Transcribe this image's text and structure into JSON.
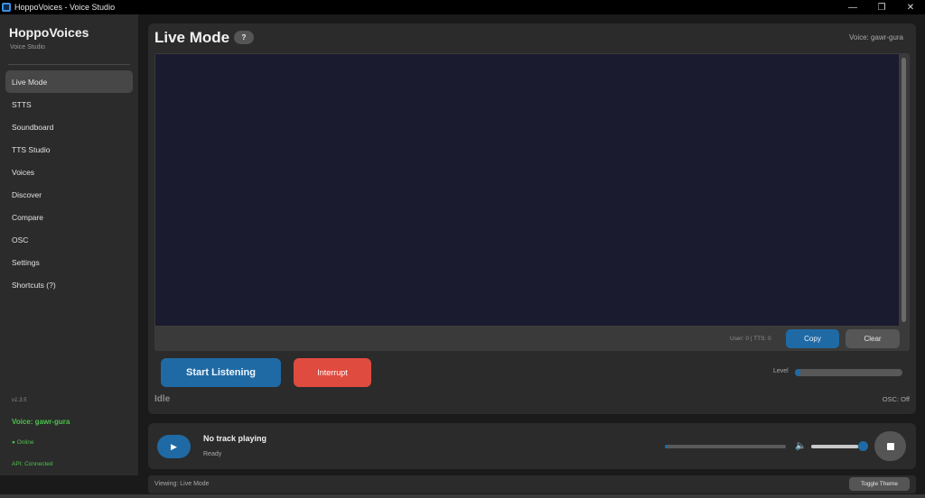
{
  "window": {
    "title": "HoppoVoices - Voice Studio",
    "controls": {
      "minimize": "—",
      "maximize": "❐",
      "close": "✕"
    }
  },
  "sidebar": {
    "brand": "HoppoVoices",
    "brand_sub": "Voice Studio",
    "items": [
      {
        "label": "Live Mode",
        "active": true
      },
      {
        "label": "STTS"
      },
      {
        "label": "Soundboard"
      },
      {
        "label": "TTS Studio"
      },
      {
        "label": "Voices"
      },
      {
        "label": "Discover"
      },
      {
        "label": "Compare"
      },
      {
        "label": "OSC"
      },
      {
        "label": "Settings"
      },
      {
        "label": "Shortcuts (?)"
      }
    ],
    "version": "v1.3.5",
    "voice": "Voice: gawr-gura",
    "online": "● Online",
    "api": "API: Connected"
  },
  "main": {
    "title": "Live Mode",
    "help_label": "?",
    "voice_label": "Voice: gawr-gura",
    "counts": "User: 0 | TTS: 0",
    "copy_label": "Copy",
    "clear_label": "Clear",
    "start_label": "Start Listening",
    "interrupt_label": "Interrupt",
    "level_label": "Level",
    "level_value": 0.05,
    "status": "Idle",
    "osc_status": "OSC: Off"
  },
  "player": {
    "play_icon": "▶",
    "track_title": "No track playing",
    "track_status": "Ready",
    "seek_progress": 0.02,
    "volume": 0.92,
    "volume_icon": "🔈"
  },
  "statusbar": {
    "viewing": "Viewing: Live Mode",
    "toggle_label": "Toggle Theme"
  },
  "colors": {
    "accent": "#1f6aa5",
    "danger": "#e04b3f",
    "online": "#4ec24e",
    "transcript_bg": "#1b1b2f"
  }
}
